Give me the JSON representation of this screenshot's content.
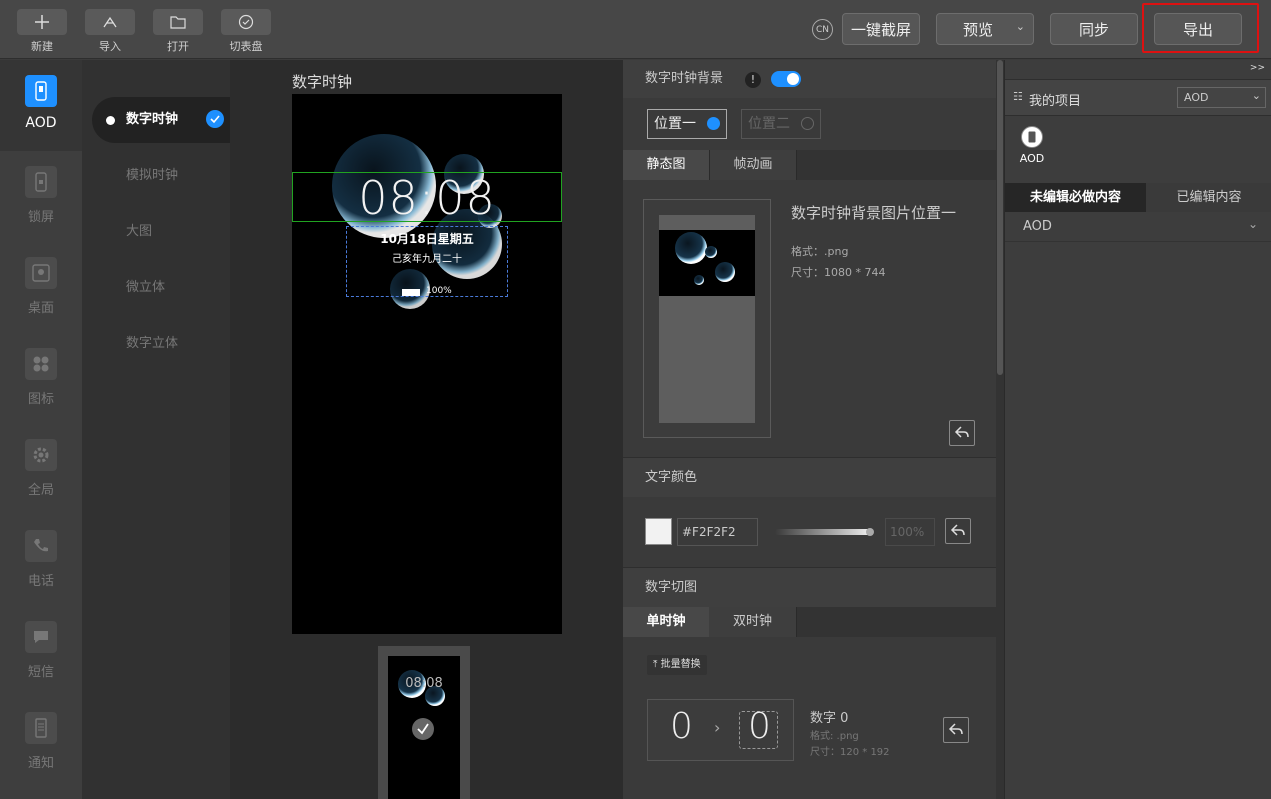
{
  "toolbar": {
    "new_label": "新建",
    "import_label": "导入",
    "open_label": "打开",
    "switch_dial_label": "切表盘",
    "lang_badge": "CN",
    "screenshot_label": "一键截屏",
    "preview_label": "预览",
    "sync_label": "同步",
    "export_label": "导出",
    "highlight_color": "#e02020"
  },
  "leftnav": [
    {
      "label": "AOD",
      "icon": "phone-icon",
      "active": true
    },
    {
      "label": "锁屏",
      "icon": "lock-icon"
    },
    {
      "label": "桌面",
      "icon": "image-icon"
    },
    {
      "label": "图标",
      "icon": "grid-icon"
    },
    {
      "label": "全局",
      "icon": "gear-icon"
    },
    {
      "label": "电话",
      "icon": "phone-call-icon"
    },
    {
      "label": "短信",
      "icon": "message-icon"
    },
    {
      "label": "通知",
      "icon": "notification-icon"
    }
  ],
  "subnav": [
    {
      "label": "数字时钟",
      "active": true
    },
    {
      "label": "模拟时钟"
    },
    {
      "label": "大图"
    },
    {
      "label": "微立体"
    },
    {
      "label": "数字立体"
    }
  ],
  "canvas": {
    "title": "数字时钟",
    "time": "08:08",
    "date": "10月18日星期五",
    "lunar": "己亥年九月二十",
    "battery": "100%",
    "thumb_time": "08:08"
  },
  "props": {
    "bg_title": "数字时钟背景",
    "position_one": "位置一",
    "position_two": "位置二",
    "tab_static": "静态图",
    "tab_animated": "帧动画",
    "bg_image_title": "数字时钟背景图片位置一",
    "bg_format": "格式：.png",
    "bg_size": "尺寸：1080 * 744",
    "text_color_title": "文字颜色",
    "text_color_hex": "#F2F2F2",
    "text_color_value": "#F2F2F2",
    "opacity": "100%",
    "digit_slice_title": "数字切图",
    "tab_single": "单时钟",
    "tab_double": "双时钟",
    "batch_replace": "批量替换",
    "digit_from": "0",
    "digit_to": "0",
    "digit_name": "数字 0",
    "digit_format": "格式: .png",
    "digit_size": "尺寸：120 * 192",
    "accent_color": "#1e90ff"
  },
  "right": {
    "collapse": ">>",
    "my_project": "我的项目",
    "project_select": "AOD",
    "project_item": "AOD",
    "tab_unedited": "未编辑必做内容",
    "tab_edited": "已编辑内容",
    "group_aod": "AOD"
  }
}
